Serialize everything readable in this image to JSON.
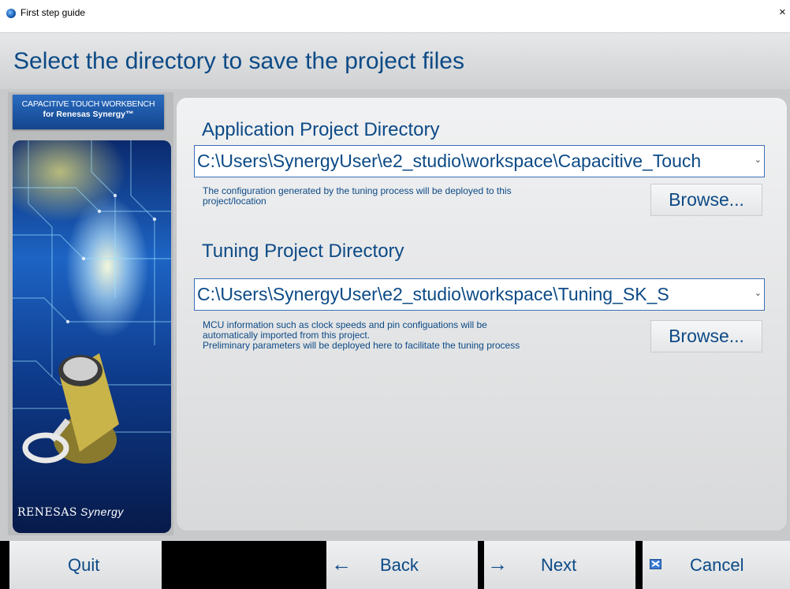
{
  "window": {
    "title": "First step guide",
    "close_glyph": "×",
    "icon": "app-logo-icon"
  },
  "header": {
    "title": "Select the directory to save the project files"
  },
  "sidebar": {
    "badge_line1": "CAPACITIVE TOUCH WORKBENCH",
    "badge_line2": "for Renesas Synergy™",
    "logo_text": "RENESAS",
    "logo_text2": "Synergy"
  },
  "app_project": {
    "heading": "Application Project Directory",
    "path": "C:\\Users\\SynergyUser\\e2_studio\\workspace\\Capacitive_Touch",
    "description": [
      "The configuration generated by the tuning process will be deployed to this",
      "project/location"
    ],
    "browse_label": "Browse..."
  },
  "tuning_project": {
    "heading": "Tuning Project Directory",
    "path": "C:\\Users\\SynergyUser\\e2_studio\\workspace\\Tuning_SK_S",
    "description": [
      "MCU information such as clock speeds and pin configuations will be",
      "automatically imported from this project.",
      "Preliminary parameters will be deployed here to facilitate the tuning process"
    ],
    "browse_label": "Browse..."
  },
  "footer": {
    "quit_label": "Quit",
    "back_label": "Back",
    "back_glyph": "←",
    "next_label": "Next",
    "next_glyph": "→",
    "cancel_label": "Cancel"
  },
  "colors": {
    "accent_text": "#0c4a86",
    "combo_border": "#3b6fb6"
  }
}
